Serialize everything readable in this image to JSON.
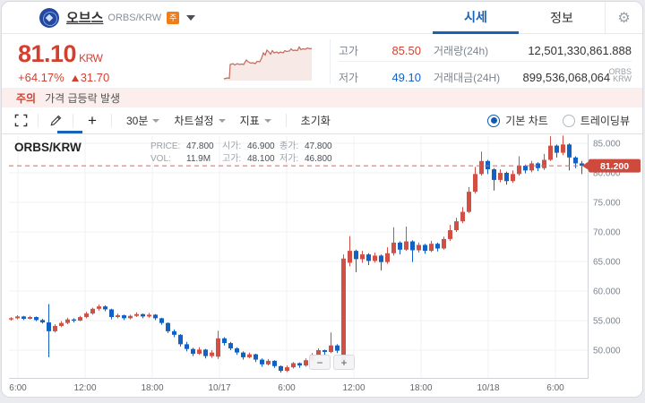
{
  "header": {
    "coin_name": "오브스",
    "coin_pair": "ORBS/KRW",
    "caution_badge": "주",
    "tabs": {
      "price": "시세",
      "info": "정보"
    },
    "price": "81.10",
    "currency": "KRW",
    "change_pct": "+64.17%",
    "change_amt": "31.70",
    "stats": {
      "high_label": "고가",
      "high": "85.50",
      "low_label": "저가",
      "low": "49.10",
      "volume_label": "거래량(24h)",
      "volume": "12,501,330,861.888",
      "volume_unit": "ORBS",
      "value_label": "거래대금(24H)",
      "value": "899,536,068,064",
      "value_unit": "KRW"
    }
  },
  "warning": {
    "tag": "주의",
    "text": "가격 급등락 발생"
  },
  "toolbar": {
    "plus_label": "+",
    "interval": "30분",
    "chart_settings": "차트설정",
    "indicator": "지표",
    "reset": "초기화",
    "basic_chart": "기본 차트",
    "tradingview": "트레이딩뷰",
    "zoom_out": "−",
    "zoom_in": "+"
  },
  "chart_data": {
    "type": "candlestick",
    "symbol": "ORBS/KRW",
    "interval": "30min",
    "info": {
      "price_label": "PRICE:",
      "price": "47.800",
      "open_label": "시가:",
      "open": "46.900",
      "close_label": "종가:",
      "close": "47.800",
      "vol_label": "VOL:",
      "vol": "11.9M",
      "high_label": "고가:",
      "high": "48.100",
      "low_label": "저가:",
      "low": "46.800"
    },
    "y_axis": {
      "values": [
        85,
        80,
        75,
        70,
        65,
        60,
        55,
        50
      ],
      "labels": [
        "85.000",
        "80.000",
        "75.000",
        "70.000",
        "65.000",
        "60.000",
        "55.000",
        "50.000"
      ],
      "range": [
        46,
        86.5
      ]
    },
    "x_axis": {
      "labels": [
        "6:00",
        "12:00",
        "18:00",
        "10/17",
        "6:00",
        "12:00",
        "18:00",
        "10/18",
        "6:00"
      ]
    },
    "current_price": 81.2,
    "current_price_label": "81.200",
    "colors": {
      "up": "#d24f45",
      "down": "#1261c4",
      "current_line": "#dd6657",
      "badge": "#ce4a3d",
      "grid": "#eff1f4",
      "axis": "#cfd2d6",
      "spark_line": "#c06a5c",
      "spark_fill": "#f7e9e6"
    },
    "candles": [
      [
        55.2,
        55.6,
        55.0,
        55.4
      ],
      [
        55.4,
        55.9,
        55.2,
        55.7
      ],
      [
        55.7,
        55.8,
        55.1,
        55.3
      ],
      [
        55.3,
        55.8,
        55.2,
        55.6
      ],
      [
        55.6,
        55.7,
        54.9,
        55.1
      ],
      [
        55.1,
        55.3,
        54.5,
        54.7
      ],
      [
        54.7,
        57.8,
        48.8,
        53.2
      ],
      [
        53.2,
        54.4,
        53.0,
        54.1
      ],
      [
        54.1,
        54.9,
        53.9,
        54.6
      ],
      [
        54.6,
        55.5,
        54.4,
        55.2
      ],
      [
        55.2,
        55.4,
        54.7,
        55.0
      ],
      [
        55.0,
        55.8,
        54.9,
        55.6
      ],
      [
        55.6,
        56.5,
        55.4,
        56.2
      ],
      [
        56.2,
        57.2,
        56.0,
        57.0
      ],
      [
        57.0,
        57.7,
        56.7,
        57.4
      ],
      [
        57.4,
        57.6,
        56.6,
        56.9
      ],
      [
        56.9,
        57.0,
        55.2,
        55.6
      ],
      [
        55.6,
        56.2,
        55.4,
        55.9
      ],
      [
        55.9,
        56.0,
        55.1,
        55.4
      ],
      [
        55.4,
        56.0,
        55.2,
        55.8
      ],
      [
        55.8,
        56.4,
        55.6,
        56.1
      ],
      [
        56.1,
        56.2,
        55.4,
        55.7
      ],
      [
        55.7,
        56.3,
        55.5,
        56.0
      ],
      [
        56.0,
        56.1,
        55.1,
        55.4
      ],
      [
        55.4,
        55.5,
        54.3,
        54.6
      ],
      [
        54.6,
        54.7,
        52.9,
        53.2
      ],
      [
        53.2,
        53.5,
        52.2,
        52.6
      ],
      [
        52.6,
        52.7,
        50.6,
        51.0
      ],
      [
        51.0,
        51.4,
        49.8,
        50.2
      ],
      [
        50.2,
        50.4,
        49.0,
        49.4
      ],
      [
        49.4,
        50.5,
        49.2,
        50.1
      ],
      [
        50.1,
        50.2,
        48.6,
        49.0
      ],
      [
        49.0,
        50.0,
        48.7,
        49.6
      ],
      [
        48.9,
        53.3,
        48.5,
        52.0
      ],
      [
        52.0,
        52.2,
        50.8,
        51.2
      ],
      [
        51.2,
        51.4,
        50.0,
        50.3
      ],
      [
        50.3,
        50.5,
        49.2,
        49.6
      ],
      [
        49.6,
        49.8,
        48.4,
        48.8
      ],
      [
        48.8,
        49.6,
        48.6,
        49.3
      ],
      [
        49.3,
        49.4,
        48.0,
        48.4
      ],
      [
        48.4,
        48.6,
        47.2,
        47.6
      ],
      [
        47.6,
        48.5,
        47.4,
        48.2
      ],
      [
        48.2,
        48.3,
        47.0,
        47.3
      ],
      [
        47.3,
        47.4,
        46.2,
        46.5
      ],
      [
        46.5,
        47.4,
        46.3,
        47.1
      ],
      [
        47.1,
        48.0,
        46.9,
        47.8
      ],
      [
        47.8,
        47.9,
        47.0,
        47.4
      ],
      [
        47.4,
        48.6,
        47.2,
        48.3
      ],
      [
        48.3,
        49.5,
        48.1,
        49.2
      ],
      [
        49.2,
        50.3,
        49.0,
        50.0
      ],
      [
        50.0,
        50.1,
        49.2,
        49.7
      ],
      [
        49.7,
        53.0,
        49.5,
        50.8
      ],
      [
        50.8,
        51.0,
        49.5,
        49.9
      ],
      [
        48.0,
        66.2,
        47.6,
        65.5
      ],
      [
        64.8,
        69.3,
        64.2,
        66.8
      ],
      [
        66.8,
        67.0,
        63.2,
        65.4
      ],
      [
        65.4,
        66.8,
        64.8,
        66.2
      ],
      [
        66.2,
        66.4,
        64.4,
        65.1
      ],
      [
        65.1,
        66.5,
        64.8,
        66.0
      ],
      [
        66.0,
        66.2,
        63.5,
        64.9
      ],
      [
        64.9,
        67.4,
        64.6,
        66.4
      ],
      [
        66.4,
        70.8,
        66.0,
        68.2
      ],
      [
        68.2,
        68.4,
        66.2,
        67.0
      ],
      [
        67.0,
        70.9,
        66.8,
        68.4
      ],
      [
        68.4,
        68.6,
        64.9,
        66.9
      ],
      [
        66.9,
        68.2,
        66.5,
        67.8
      ],
      [
        67.8,
        68.0,
        66.3,
        66.8
      ],
      [
        66.8,
        68.5,
        66.6,
        68.0
      ],
      [
        68.0,
        68.2,
        66.7,
        67.2
      ],
      [
        67.2,
        69.2,
        67.0,
        68.8
      ],
      [
        68.8,
        71.2,
        68.5,
        70.3
      ],
      [
        70.3,
        72.4,
        70.0,
        71.8
      ],
      [
        71.8,
        74.2,
        71.5,
        73.4
      ],
      [
        73.4,
        77.6,
        73.2,
        76.8
      ],
      [
        76.8,
        81.0,
        76.5,
        79.8
      ],
      [
        79.8,
        83.6,
        79.5,
        82.0
      ],
      [
        82.0,
        82.2,
        79.8,
        80.6
      ],
      [
        80.6,
        80.8,
        77.0,
        78.8
      ],
      [
        78.8,
        80.6,
        78.4,
        80.0
      ],
      [
        80.0,
        80.2,
        78.0,
        78.6
      ],
      [
        78.6,
        80.4,
        78.3,
        79.8
      ],
      [
        79.8,
        82.8,
        79.5,
        81.2
      ],
      [
        81.2,
        81.4,
        79.9,
        80.4
      ],
      [
        80.4,
        82.0,
        80.1,
        81.6
      ],
      [
        81.6,
        81.8,
        80.3,
        80.8
      ],
      [
        80.8,
        83.2,
        80.5,
        82.2
      ],
      [
        82.2,
        86.2,
        82.0,
        84.6
      ],
      [
        84.6,
        84.8,
        82.6,
        83.4
      ],
      [
        83.4,
        86.3,
        83.0,
        84.8
      ],
      [
        84.8,
        85.0,
        80.4,
        82.6
      ],
      [
        82.6,
        82.8,
        80.8,
        81.6
      ],
      [
        81.6,
        82.0,
        79.8,
        81.2
      ]
    ],
    "sparkline": {
      "type": "area",
      "points": [
        [
          2,
          44
        ],
        [
          6,
          43
        ],
        [
          8,
          43.5
        ],
        [
          9,
          28
        ],
        [
          12,
          27
        ],
        [
          14,
          28.5
        ],
        [
          17,
          27
        ],
        [
          19,
          28
        ],
        [
          22,
          27.5
        ],
        [
          24,
          28
        ],
        [
          27,
          23
        ],
        [
          29,
          25
        ],
        [
          32,
          26.5
        ],
        [
          34,
          26
        ],
        [
          37,
          27
        ],
        [
          39,
          24.5
        ],
        [
          42,
          25
        ],
        [
          44,
          21
        ],
        [
          46,
          15
        ],
        [
          48,
          17.5
        ],
        [
          50,
          12
        ],
        [
          52,
          14
        ],
        [
          54,
          16.5
        ],
        [
          56,
          12.5
        ],
        [
          58,
          15
        ],
        [
          61,
          14
        ],
        [
          63,
          15.5
        ],
        [
          65,
          14
        ],
        [
          68,
          15
        ],
        [
          70,
          12.5
        ],
        [
          72,
          13.5
        ],
        [
          75,
          13
        ],
        [
          77,
          10.5
        ],
        [
          79,
          12.5
        ],
        [
          81,
          12
        ],
        [
          84,
          12.5
        ],
        [
          86,
          8.5
        ],
        [
          88,
          11.5
        ],
        [
          90,
          10.5
        ],
        [
          93,
          11
        ],
        [
          95,
          9.5
        ],
        [
          98,
          10.5
        ],
        [
          100,
          10
        ]
      ]
    }
  }
}
